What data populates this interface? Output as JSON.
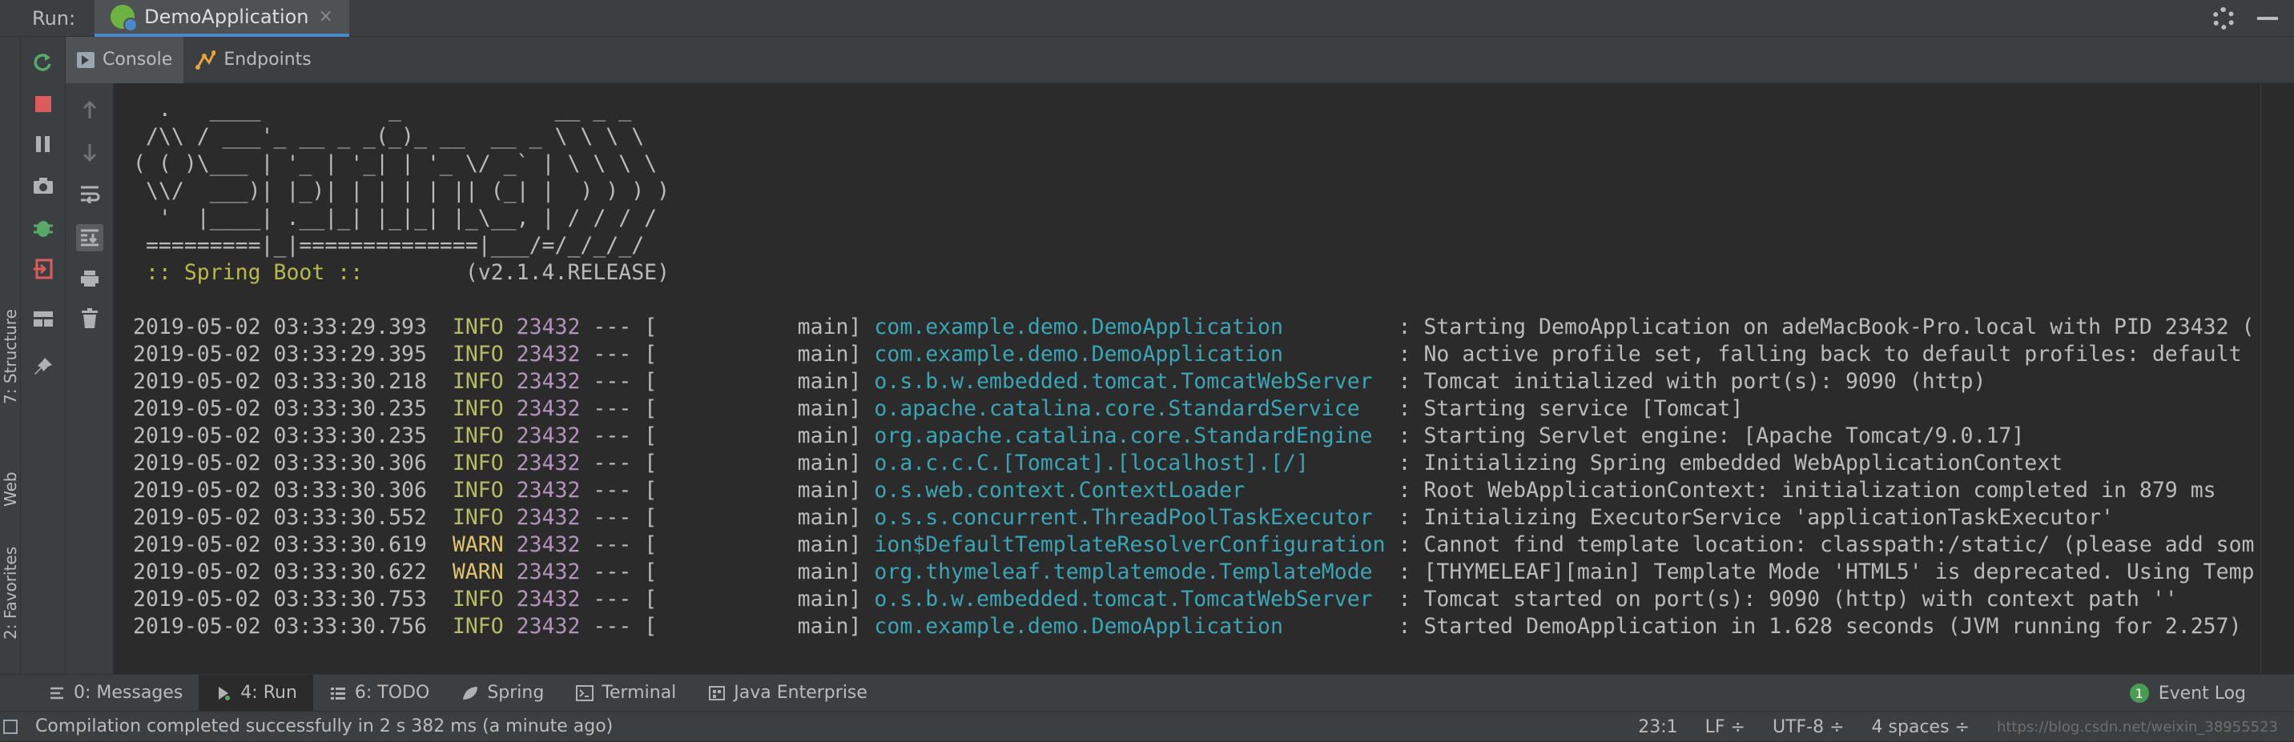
{
  "header": {
    "run_label": "Run:",
    "tab_title": "DemoApplication",
    "close": "×"
  },
  "left_stripe": {
    "structure": "7: Structure",
    "web": "Web",
    "favorites": "2: Favorites"
  },
  "sub_tabs": {
    "console": "Console",
    "endpoints": "Endpoints"
  },
  "console": {
    "banner": [
      "  .   ____          _            __ _ _",
      " /\\\\ / ___'_ __ _ _(_)_ __  __ _ \\ \\ \\ \\",
      "( ( )\\___ | '_ | '_| | '_ \\/ _` | \\ \\ \\ \\",
      " \\\\/  ___)| |_)| | | | | || (_| |  ) ) ) )",
      "  '  |____| .__|_| |_|_| |_\\__, | / / / /",
      " =========|_|==============|___/=/_/_/_/"
    ],
    "spring_boot_label": " :: Spring Boot :: ",
    "spring_boot_version": "       (v2.1.4.RELEASE)",
    "logs": [
      {
        "ts": "2019-05-02 03:33:29.393",
        "level": "INFO",
        "pid": "23432",
        "sep": " --- [           main] ",
        "logger": "com.example.demo.DemoApplication        ",
        "msg": " : Starting DemoApplication on adeMacBook-Pro.local with PID 23432 ("
      },
      {
        "ts": "2019-05-02 03:33:29.395",
        "level": "INFO",
        "pid": "23432",
        "sep": " --- [           main] ",
        "logger": "com.example.demo.DemoApplication        ",
        "msg": " : No active profile set, falling back to default profiles: default"
      },
      {
        "ts": "2019-05-02 03:33:30.218",
        "level": "INFO",
        "pid": "23432",
        "sep": " --- [           main] ",
        "logger": "o.s.b.w.embedded.tomcat.TomcatWebServer ",
        "msg": " : Tomcat initialized with port(s): 9090 (http)"
      },
      {
        "ts": "2019-05-02 03:33:30.235",
        "level": "INFO",
        "pid": "23432",
        "sep": " --- [           main] ",
        "logger": "o.apache.catalina.core.StandardService  ",
        "msg": " : Starting service [Tomcat]"
      },
      {
        "ts": "2019-05-02 03:33:30.235",
        "level": "INFO",
        "pid": "23432",
        "sep": " --- [           main] ",
        "logger": "org.apache.catalina.core.StandardEngine ",
        "msg": " : Starting Servlet engine: [Apache Tomcat/9.0.17]"
      },
      {
        "ts": "2019-05-02 03:33:30.306",
        "level": "INFO",
        "pid": "23432",
        "sep": " --- [           main] ",
        "logger": "o.a.c.c.C.[Tomcat].[localhost].[/]      ",
        "msg": " : Initializing Spring embedded WebApplicationContext"
      },
      {
        "ts": "2019-05-02 03:33:30.306",
        "level": "INFO",
        "pid": "23432",
        "sep": " --- [           main] ",
        "logger": "o.s.web.context.ContextLoader           ",
        "msg": " : Root WebApplicationContext: initialization completed in 879 ms"
      },
      {
        "ts": "2019-05-02 03:33:30.552",
        "level": "INFO",
        "pid": "23432",
        "sep": " --- [           main] ",
        "logger": "o.s.s.concurrent.ThreadPoolTaskExecutor ",
        "msg": " : Initializing ExecutorService 'applicationTaskExecutor'"
      },
      {
        "ts": "2019-05-02 03:33:30.619",
        "level": "WARN",
        "pid": "23432",
        "sep": " --- [           main] ",
        "logger": "ion$DefaultTemplateResolverConfiguration",
        "msg": " : Cannot find template location: classpath:/static/ (please add som"
      },
      {
        "ts": "2019-05-02 03:33:30.622",
        "level": "WARN",
        "pid": "23432",
        "sep": " --- [           main] ",
        "logger": "org.thymeleaf.templatemode.TemplateMode ",
        "msg": " : [THYMELEAF][main] Template Mode 'HTML5' is deprecated. Using Temp"
      },
      {
        "ts": "2019-05-02 03:33:30.753",
        "level": "INFO",
        "pid": "23432",
        "sep": " --- [           main] ",
        "logger": "o.s.b.w.embedded.tomcat.TomcatWebServer ",
        "msg": " : Tomcat started on port(s): 9090 (http) with context path ''"
      },
      {
        "ts": "2019-05-02 03:33:30.756",
        "level": "INFO",
        "pid": "23432",
        "sep": " --- [           main] ",
        "logger": "com.example.demo.DemoApplication        ",
        "msg": " : Started DemoApplication in 1.628 seconds (JVM running for 2.257)"
      }
    ]
  },
  "bottom_tabs": [
    {
      "label": "0: Messages"
    },
    {
      "label": "4: Run"
    },
    {
      "label": "6: TODO"
    },
    {
      "label": "Spring"
    },
    {
      "label": "Terminal"
    },
    {
      "label": "Java Enterprise"
    }
  ],
  "event_log": {
    "count": "1",
    "label": "Event Log"
  },
  "status": {
    "message": "Compilation completed successfully in 2 s 382 ms (a minute ago)",
    "position": "23:1",
    "line_sep": "LF ÷",
    "encoding": "UTF-8 ÷",
    "indent": "4 spaces ÷",
    "watermark": "https://blog.csdn.net/weixin_38955523"
  },
  "colors": {
    "accent": "#4a88c7",
    "info": "#b5bd68",
    "warn": "#e0c46c",
    "pid": "#b294bb",
    "logger": "#3ba5b5",
    "spring": "#6db33f"
  }
}
